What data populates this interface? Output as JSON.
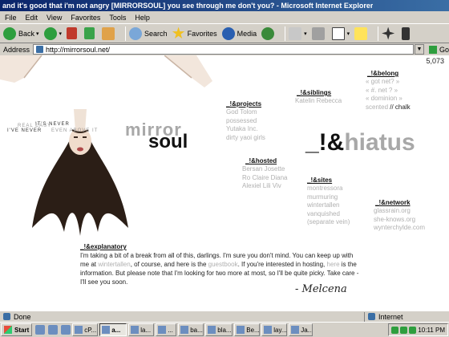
{
  "window": {
    "title": "and it's good that i'm not angry    [MIRRORSOUL]    you see through me don't you?  - Microsoft Internet Explorer"
  },
  "menu": [
    "File",
    "Edit",
    "View",
    "Favorites",
    "Tools",
    "Help"
  ],
  "toolbar": {
    "back": "Back",
    "search": "Search",
    "favorites": "Favorites",
    "media": "Media"
  },
  "address": {
    "label": "Address",
    "url": "http://mirrorsoul.net/",
    "go": "Go"
  },
  "page": {
    "counter": "5,073",
    "logo_mirror": "mirror",
    "logo_soul": "soul",
    "tagline": [
      "IT'S NEVER",
      "I'VE NEVER",
      "EVEN ABOVE IT",
      "REAL  EASY"
    ],
    "hiatus_prefix": "_!&",
    "hiatus_word": "hiatus",
    "projects": {
      "heading": "_!&projects",
      "items": [
        "God Tolom",
        "possessed",
        "Yutaka Inc.",
        "dirty yaoi girls"
      ]
    },
    "siblings": {
      "heading": "_!&siblings",
      "items": [
        "Katelin Rebecca"
      ]
    },
    "belong": {
      "heading": "_!&belong",
      "items": [
        "« got net? »",
        "« #. net ? »",
        "« dominion »"
      ],
      "last_link": "scented",
      "last_text": " // chalk"
    },
    "hosted": {
      "heading": "_!&hosted",
      "items": [
        "Bersan Josette",
        "Ro Claire Diana",
        "Alexiel Lili Viv"
      ]
    },
    "sites": {
      "heading": "_!&sites",
      "items": [
        "montressora",
        "murmuring",
        "wintertallen",
        "vanquished",
        "(separate vein)"
      ]
    },
    "network": {
      "heading": "_!&network",
      "items": [
        "glassrain.org",
        "she-knows.org",
        "wynterchylde.com"
      ]
    },
    "explanatory": {
      "heading": "_!&explanatory",
      "p1": "I'm taking a bit of a break from all of this, darlings. I'm sure you don't mind. You can keep up with me at ",
      "link1": "wintertallen",
      "p2": ", of course, and here is the ",
      "link2": "guestbook",
      "p3": ". If you're interested in hosting, ",
      "link3": "here",
      "p4": " is the information. But please note that I'm looking for two more at most, so I'll be quite picky. Take care - I'll see you soon.",
      "signature": "- Melcena"
    }
  },
  "status": {
    "text": "Done",
    "zone": "Internet"
  },
  "taskbar": {
    "start": "Start",
    "buttons": [
      "cP...",
      "a...",
      "la...",
      "...",
      "ba...",
      "bla...",
      "Be...",
      "lay...",
      "Ja..."
    ],
    "active_index": 1,
    "time": "10:11 PM"
  }
}
